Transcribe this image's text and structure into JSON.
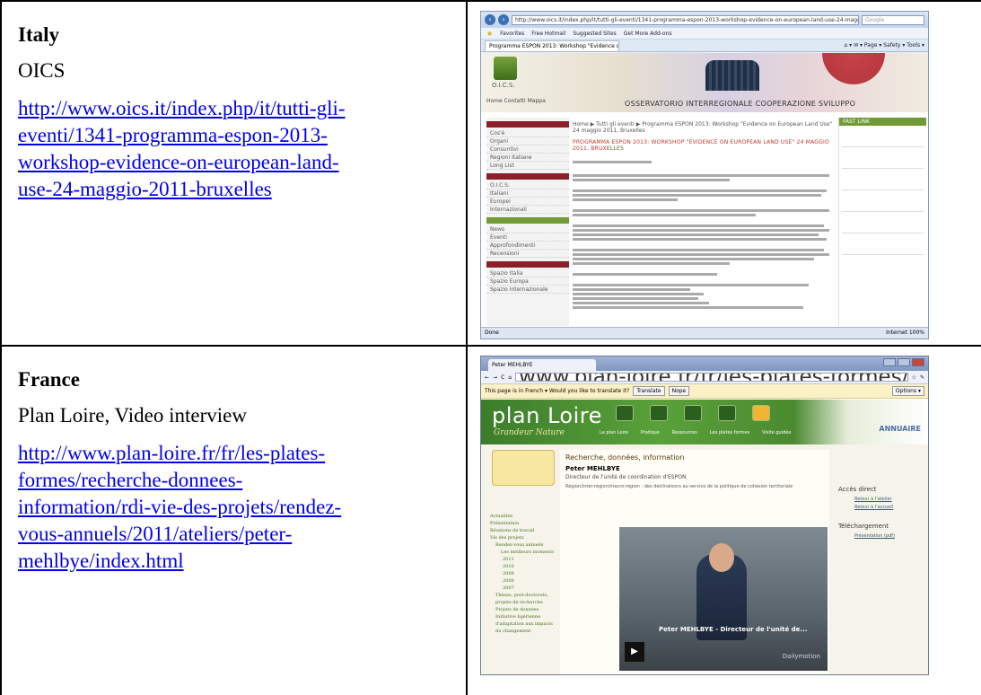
{
  "rows": [
    {
      "country": "Italy",
      "organisation": "OICS",
      "url": "http://www.oics.it/index.php/it/tutti-gli-eventi/1341-programma-espon-2013-workshop-evidence-on-european-land-use-24-maggio-2011-bruxelles",
      "url_lines": [
        "http://www.oics.it/index.php/it/tutti-gli-",
        "eventi/1341-programma-espon-2013-",
        "workshop-evidence-on-european-land-",
        "use-24-maggio-2011-bruxelles"
      ],
      "screenshot": {
        "browser": "Internet Explorer",
        "favorites": [
          "Favorites",
          "Free Hotmail",
          "Suggested Sites",
          "Get More Add-ons"
        ],
        "tab_title": "Programma ESPON 2013: Workshop \"Evidence on Eu...",
        "site_logo": "O.I.C.S.",
        "site_header": "OSSERVATORIO INTERREGIONALE COOPERAZIONE SVILUPPO",
        "home_links": "Home  Contatti  Mappa",
        "breadcrumb": "Home ▶ Tutti gli eventi ▶ Programma ESPON 2013: Workshop \"Evidence on European Land Use\" 24 maggio 2011, Bruxelles",
        "article_title": "PROGRAMMA ESPON 2013: WORKSHOP \"EVIDENCE ON EUROPEAN LAND USE\" 24 MAGGIO 2011, BRUXELLES",
        "nav_items": [
          "Cos'è",
          "Organi",
          "Consuntivi",
          "Regioni Italiane",
          "Long List",
          "O.I.C.S.",
          "Italiani",
          "Europei",
          "Internazionali",
          "News",
          "Eventi",
          "Approfondimenti",
          "Recensioni",
          "Spazio Italia",
          "Spazio Europa",
          "Spazio Internazionale"
        ],
        "fast_link": "FAST LINK",
        "status_left": "Done",
        "status_right": "Internet   100%"
      }
    },
    {
      "country": "France",
      "organisation": "Plan Loire, Video interview",
      "url": "http://www.plan-loire.fr/fr/les-plates-formes/recherche-donnees-information/rdi-vie-des-projets/rendez-vous-annuels/2011/ateliers/peter-mehlbye/index.html",
      "url_lines": [
        "http://www.plan-loire.fr/fr/les-plates-",
        "formes/recherche-donnees-",
        "information/rdi-vie-des-projets/rendez-",
        "vous-annuels/2011/ateliers/peter-",
        "mehlbye/index.html"
      ],
      "screenshot": {
        "browser": "Chrome",
        "tab_title": "Peter MEHLBYE",
        "omnibox": "www.plan-loire.fr/fr/les-plates-formes/recherche-donnees-information/rdi-vie-des-projets/rendez-vous-annuels/2011/ateliers/peter-mehlbye/",
        "translate_text": "This page is in French ▾  Would you like to translate it?",
        "translate_btn": "Translate",
        "nope_btn": "Nope",
        "options_btn": "Options ▾",
        "brand": "plan Loire",
        "tagline": "Grandeur Nature",
        "menu": [
          "Le plan Loire",
          "Pratique",
          "Ressources",
          "Les plates formes",
          "Visite guidée"
        ],
        "annuaire": "ANNUAIRE",
        "section_title": "Recherche, données, information",
        "person": "Peter MEHLBYE",
        "role": "Directeur de l'unité de coordination d'ESPON",
        "subtitle": "Région/inter-région/macro-région : des déclinaisons au service de la politique de cohésion territoriale",
        "left_menu": [
          "Actualités",
          "Présentation",
          "Réunions de travail",
          "Vie des projets",
          "Rendez-vous annuels",
          "Les meilleurs moments",
          "2011",
          "2010",
          "2009",
          "2008",
          "2007",
          "Thèses, post-doctorats, projets de recherche",
          "Projets de données",
          "Initiative ligérienne d'adaptation aux impacts du changement"
        ],
        "video_caption": "Peter MEHLBYE - Directeur de l'unité de...",
        "video_brand": "Dailymotion",
        "acces_direct": "Accès direct",
        "acces_links": [
          "Retour à l'atelier",
          "Retour à l'accueil"
        ],
        "telechargement": "Téléchargement",
        "download_link": "Présentation (pdf)"
      }
    }
  ]
}
